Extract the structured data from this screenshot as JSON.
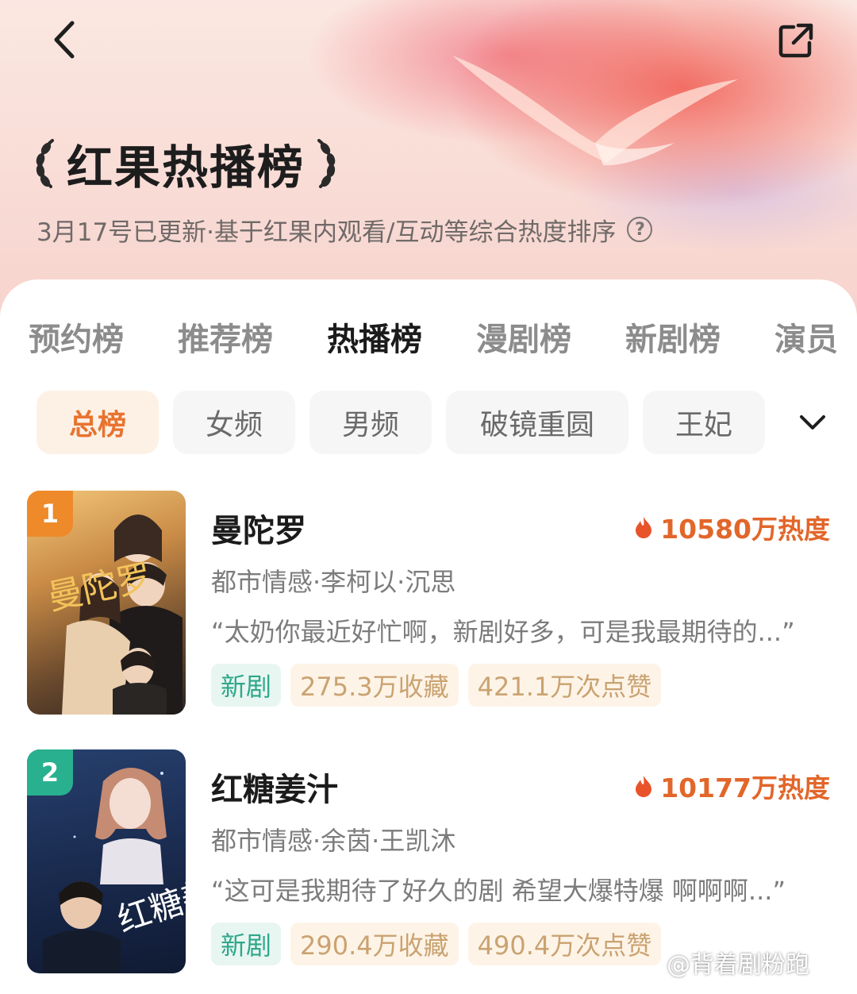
{
  "header": {
    "title": "红果热播榜",
    "subtitle": "3月17号已更新·基于红果内观看/互动等综合热度排序",
    "help_glyph": "?"
  },
  "tabs": [
    "预约榜",
    "推荐榜",
    "热播榜",
    "漫剧榜",
    "新剧榜",
    "演员"
  ],
  "active_tab": "热播榜",
  "chips": [
    "总榜",
    "女频",
    "男频",
    "破镜重圆",
    "王妃"
  ],
  "active_chip": "总榜",
  "rankings": [
    {
      "rank": "1",
      "title": "曼陀罗",
      "heat": "10580万热度",
      "meta": "都市情感·李柯以·沉思",
      "quote": "“太奶你最近好忙啊，新剧好多，可是我最期待的...”",
      "tags": [
        "新剧",
        "275.3万收藏",
        "421.1万次点赞"
      ],
      "badge_color": "#ee8a2a",
      "poster_text": "曼陀罗"
    },
    {
      "rank": "2",
      "title": "红糖姜汁",
      "heat": "10177万热度",
      "meta": "都市情感·余茵·王凯沐",
      "quote": "“这可是我期待了好久的剧 希望大爆特爆 啊啊啊...”",
      "tags": [
        "新剧",
        "290.4万收藏",
        "490.4万次点赞"
      ],
      "badge_color": "#29b08f",
      "poster_text": "红糖姜汁"
    }
  ],
  "watermark": "@背着剧粉跑",
  "colors": {
    "accent": "#e8732f",
    "heat": "#e2662a",
    "new_tag": "#2ea78a",
    "stat_tag": "#caa271"
  },
  "icons": [
    "back-arrow-icon",
    "share-icon",
    "laurel-left-icon",
    "laurel-right-icon",
    "help-icon",
    "chevron-down-icon",
    "flame-icon"
  ]
}
